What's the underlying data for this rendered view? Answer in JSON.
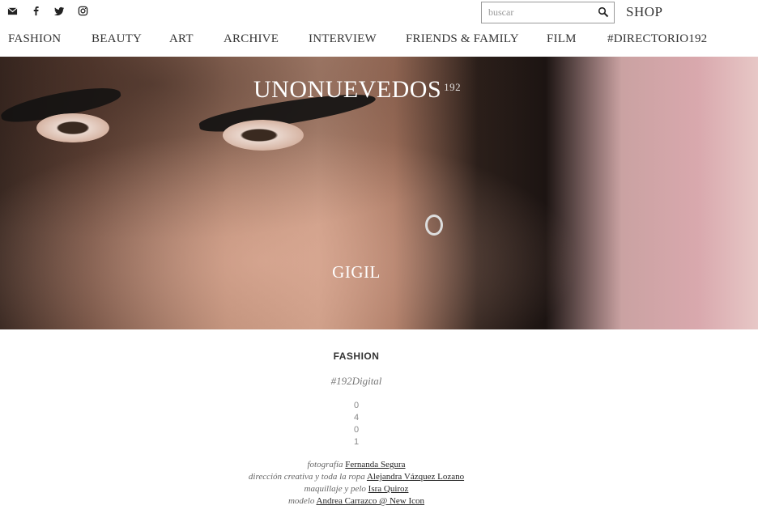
{
  "social": {
    "icons": [
      "mail-icon",
      "facebook-icon",
      "twitter-icon",
      "instagram-icon"
    ]
  },
  "search": {
    "placeholder": "buscar",
    "icon": "search-icon"
  },
  "shop_label": "SHOP",
  "nav": {
    "items": [
      "FASHION",
      "BEAUTY",
      "ART",
      "ARCHIVE",
      "INTERVIEW",
      "FRIENDS & FAMILY",
      "FILM",
      "#DIRECTORIO192"
    ]
  },
  "hero": {
    "logo": "UNONUEVEDOS",
    "logo_sup": "192",
    "title": "GIGIL"
  },
  "article": {
    "category": "FASHION",
    "tag": "#192Digital",
    "counter": [
      "0",
      "4",
      "0",
      "1"
    ],
    "credits": [
      {
        "role": "fotografía",
        "name": "Fernanda Segura"
      },
      {
        "role": "dirección creativa y toda la ropa",
        "name": "Alejandra Vázquez Lozano"
      },
      {
        "role": "maquillaje y pelo",
        "name": "Isra Quiroz"
      },
      {
        "role": "modelo",
        "name": "Andrea Carrazco @ New Icon"
      }
    ]
  },
  "colors": {
    "text": "#222222",
    "nav_text": "#333333",
    "muted": "#777777",
    "hero_text": "#ffffff"
  }
}
